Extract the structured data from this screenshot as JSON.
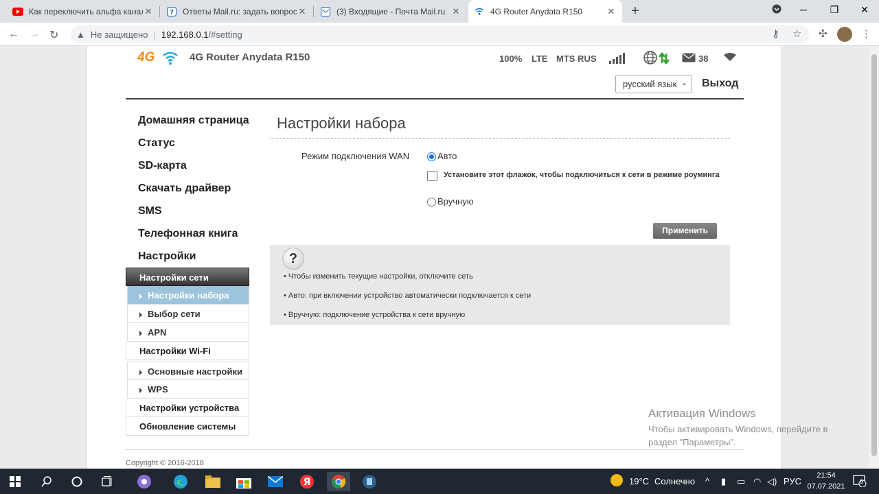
{
  "browser": {
    "tabs": [
      {
        "title": "Как переключить альфа канал в",
        "icon": "youtube-icon"
      },
      {
        "title": "Ответы Mail.ru: задать вопрос",
        "icon": "question-icon"
      },
      {
        "title": "(3) Входящие - Почта Mail.ru",
        "icon": "mail-icon"
      },
      {
        "title": "4G Router Anydata R150",
        "icon": "wifi-icon"
      }
    ],
    "security_label": "Не защищено",
    "url_host": "192.168.0.1",
    "url_path": "/#setting"
  },
  "header": {
    "logo_text": "4G",
    "title": "4G Router Anydata R150",
    "battery": "100%",
    "network_type": "LTE",
    "operator": "MTS RUS",
    "sms_count": "38",
    "language": "русский язык",
    "logout": "Выход"
  },
  "sidebar": {
    "main_items": [
      "Домашняя страница",
      "Статус",
      "SD-карта",
      "Скачать драйвер",
      "SMS",
      "Телефонная книга",
      "Настройки"
    ],
    "network_settings": "Настройки сети",
    "network_subitems": [
      "Настройки набора",
      "Выбор сети",
      "APN"
    ],
    "wifi_settings": "Настройки Wi-Fi",
    "wifi_subitems": [
      "Основные настройки",
      "WPS"
    ],
    "device_settings": "Настройки устройства",
    "system_update": "Обновление системы"
  },
  "content": {
    "title": "Настройки набора",
    "wan_label": "Режим подключения WAN",
    "option_auto": "Авто",
    "roaming_checkbox": "Установите этот флажок, чтобы подключиться к сети в режиме роуминга",
    "option_manual": "Вручную",
    "apply": "Применить",
    "help": {
      "icon": "?",
      "lines": [
        "• Чтобы изменить текущие настройки, отключите сеть",
        "• Авто: при включении устройство автоматически подключается к сети",
        "• Вручную: подключение устройства к сети вручную"
      ]
    }
  },
  "footer": {
    "copyright": "Copyright © 2016-2018"
  },
  "activation": {
    "title": "Активация Windows",
    "line1": "Чтобы активировать Windows, перейдите в",
    "line2": "раздел \"Параметры\"."
  },
  "taskbar": {
    "temperature": "19°C",
    "weather": "Солнечно",
    "language": "РУС",
    "time": "21:54",
    "date": "07.07.2021",
    "notifications": "9"
  },
  "colors": {
    "accent_orange": "#f08a1c",
    "active_sub": "#9cc4dd",
    "taskbar": "#1f2832"
  }
}
